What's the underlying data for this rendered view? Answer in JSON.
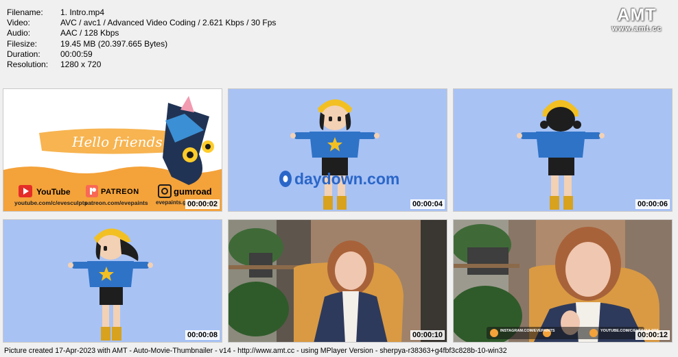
{
  "info": {
    "rows": [
      {
        "label": "Filename:",
        "value": "1. Intro.mp4"
      },
      {
        "label": "Video:",
        "value": "AVC / avc1 / Advanced Video Coding / 2.621 Kbps / 30 Fps"
      },
      {
        "label": "Audio:",
        "value": "AAC / 128 Kbps"
      },
      {
        "label": "Filesize:",
        "value": "19.45 MB (20.397.665 Bytes)"
      },
      {
        "label": "Duration:",
        "value": "00:00:59"
      },
      {
        "label": "Resolution:",
        "value": "1280 x 720"
      }
    ]
  },
  "logo": {
    "big": "AMT",
    "small": "www.amt.cc"
  },
  "thumbs": [
    {
      "timestamp": "00:00:02",
      "banner_text": "Hello friends",
      "links": [
        {
          "brand": "YouTube",
          "url": "youtube.com/c/evesculpts"
        },
        {
          "brand": "PATREON",
          "url": "patreon.com/evepaints"
        },
        {
          "brand": "gumroad",
          "url": "evepaints.gumroad.com"
        }
      ]
    },
    {
      "timestamp": "00:00:04",
      "watermark": "daydown.com"
    },
    {
      "timestamp": "00:00:06"
    },
    {
      "timestamp": "00:00:08"
    },
    {
      "timestamp": "00:00:10"
    },
    {
      "timestamp": "00:00:12",
      "social": [
        "INSTAGRAM.COM/EVEPAINTS",
        "YOUTUBE.COM/C/EVESCULPTS"
      ]
    }
  ],
  "footer": "Picture created 17-Apr-2023 with AMT - Auto-Movie-Thumbnailer - v14 - http://www.amt.cc - using MPlayer Version - sherpya-r38363+g4fbf3c828b-10-win32",
  "colors": {
    "bg": "#f0f0f0",
    "blue_bg": "#a8c2f4",
    "orange": "#f4a23a",
    "youtube_red": "#e52d27",
    "patreon_red": "#f96854"
  }
}
